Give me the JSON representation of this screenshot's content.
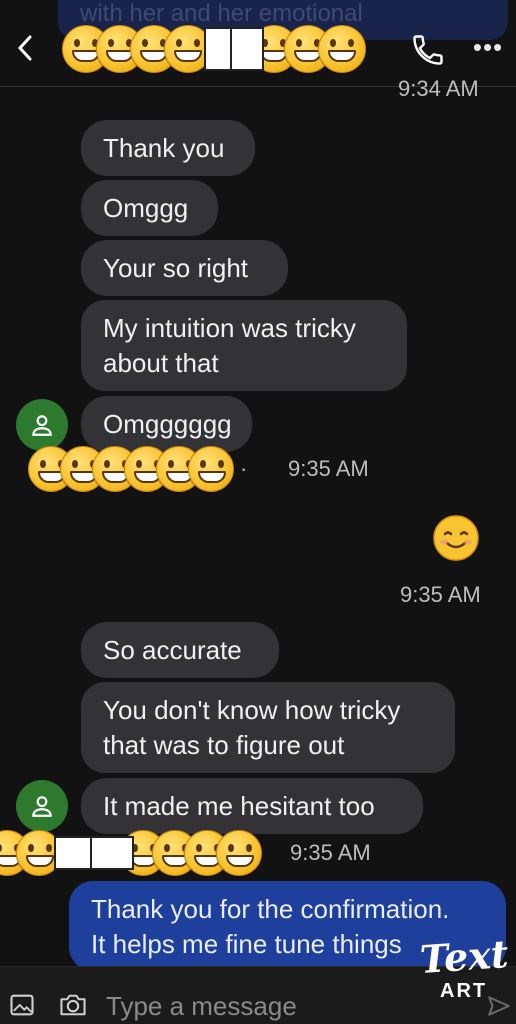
{
  "header": {
    "peek_text": "with her and her emotional",
    "top_timestamp": "9:34 AM"
  },
  "messages": {
    "thank_you": "Thank you",
    "omggg": "Omggg",
    "your_so_right": "Your so right",
    "intuition_line1": "My intuition was tricky",
    "intuition_line2": "about that",
    "omgggggg": "Omgggggg",
    "time1": "9:35 AM",
    "time2": "9:35 AM",
    "so_accurate": "So accurate",
    "dont_know_line1": "You don't know how tricky",
    "dont_know_line2": "that was to figure out",
    "hesitant": "It made me hesitant too",
    "time3": "9:35 AM",
    "sent_line1": "Thank you for the confirmation.",
    "sent_line2": "It helps me fine tune things"
  },
  "composer": {
    "placeholder": "Type a message"
  },
  "watermark": {
    "line1": "Text",
    "line2": "ART"
  },
  "colors": {
    "background": "#121212",
    "received_bubble": "#333336",
    "sent_bubble": "#1e3f9c",
    "avatar": "#2d7a2f"
  },
  "icons": [
    "back-icon",
    "phone-icon",
    "more-icon",
    "person-icon",
    "gallery-icon",
    "camera-icon",
    "send-icon",
    "emoji-icon"
  ]
}
